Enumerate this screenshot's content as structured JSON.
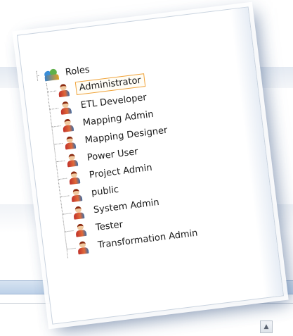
{
  "tree": {
    "root_label": "Roles",
    "root_icon": "roles-group-icon",
    "item_icon": "user-role-icon",
    "selected_index": 0,
    "items": [
      {
        "label": "Administrator"
      },
      {
        "label": "ETL Developer"
      },
      {
        "label": "Mapping Admin"
      },
      {
        "label": "Mapping Designer"
      },
      {
        "label": "Power User"
      },
      {
        "label": "Project Admin"
      },
      {
        "label": "public"
      },
      {
        "label": "System Admin"
      },
      {
        "label": "Tester"
      },
      {
        "label": "Transformation Admin"
      }
    ]
  },
  "colors": {
    "selection_border": "#f0a33a",
    "tree_lines": "#909090",
    "card_border": "#c9d3df"
  }
}
